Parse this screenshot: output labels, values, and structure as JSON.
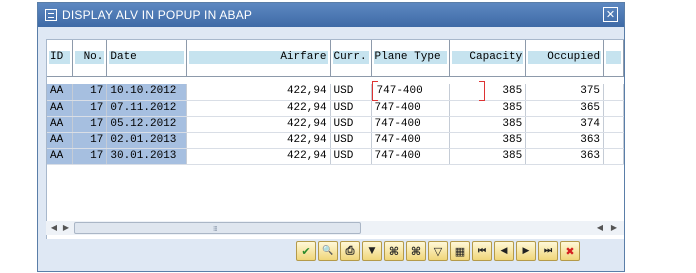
{
  "window": {
    "title": "DISPLAY ALV IN POPUP IN ABAP",
    "close_glyph": "✕"
  },
  "table": {
    "columns": [
      "ID",
      "No.",
      "Date",
      "Airfare",
      "Curr.",
      "Plane Type",
      "Capacity",
      "Occupied"
    ],
    "rows": [
      [
        "AA",
        "17",
        "10.10.2012",
        "422,94",
        "USD",
        "747-400",
        "385",
        "375"
      ],
      [
        "AA",
        "17",
        "07.11.2012",
        "422,94",
        "USD",
        "747-400",
        "385",
        "365"
      ],
      [
        "AA",
        "17",
        "05.12.2012",
        "422,94",
        "USD",
        "747-400",
        "385",
        "374"
      ],
      [
        "AA",
        "17",
        "02.01.2013",
        "422,94",
        "USD",
        "747-400",
        "385",
        "363"
      ],
      [
        "AA",
        "17",
        "30.01.2013",
        "422,94",
        "USD",
        "747-400",
        "385",
        "363"
      ]
    ]
  },
  "scrollbar": {
    "left_glyph": "◀",
    "right_glyph": "▶",
    "grip_glyph": "⁞⁞⁞"
  },
  "toolbar": {
    "buttons": [
      {
        "name": "continue-button",
        "glyph": "✔",
        "icon": "check-icon"
      },
      {
        "name": "details-button",
        "glyph": "🔍",
        "icon": "magnifier-icon"
      },
      {
        "name": "print-button",
        "glyph": "⎙",
        "icon": "printer-icon"
      },
      {
        "name": "sort-button",
        "glyph": "▼",
        "icon": "sort-icon"
      },
      {
        "name": "find-button",
        "glyph": "⌘",
        "icon": "binoculars-icon"
      },
      {
        "name": "find-next-button",
        "glyph": "⌘",
        "icon": "binoculars-next-icon"
      },
      {
        "name": "filter-button",
        "glyph": "▽",
        "icon": "filter-icon"
      },
      {
        "name": "layout-button",
        "glyph": "▦",
        "icon": "grid-icon"
      },
      {
        "name": "first-page-button",
        "glyph": "⏮",
        "icon": "first-icon"
      },
      {
        "name": "previous-page-button",
        "glyph": "◀",
        "icon": "previous-icon"
      },
      {
        "name": "next-page-button",
        "glyph": "▶",
        "icon": "next-icon"
      },
      {
        "name": "last-page-button",
        "glyph": "⏭",
        "icon": "last-icon"
      },
      {
        "name": "cancel-button",
        "glyph": "✖",
        "icon": "cancel-icon"
      }
    ]
  },
  "colors": {
    "title_bar": "#4a76b2",
    "key_cell": "#a6bfe0",
    "header_cell": "#c6e3ef"
  }
}
